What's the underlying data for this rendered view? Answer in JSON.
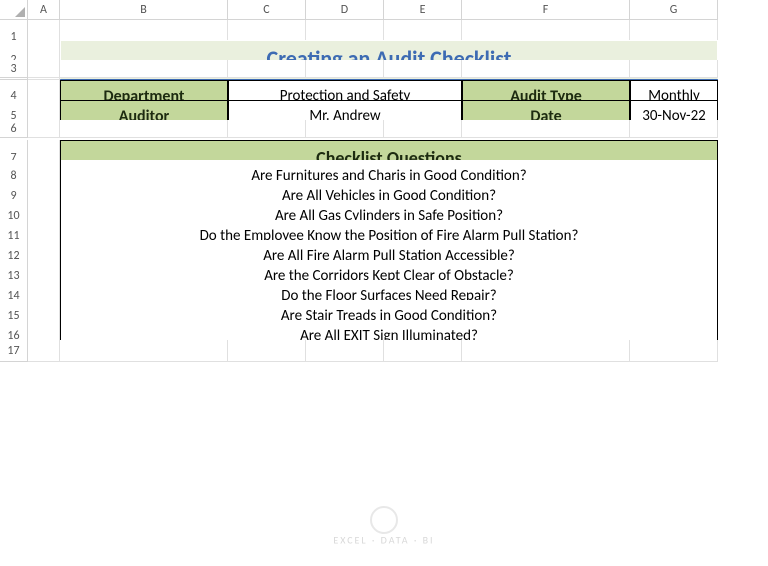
{
  "columns": [
    "A",
    "B",
    "C",
    "D",
    "E",
    "F",
    "G"
  ],
  "rows": [
    "1",
    "2",
    "3",
    "4",
    "5",
    "6",
    "7",
    "8",
    "9",
    "10",
    "11",
    "12",
    "13",
    "14",
    "15",
    "16",
    "17"
  ],
  "title": "Creating an Audit Checklist",
  "meta": {
    "department_label": "Department",
    "department_value": "Protection and Safety",
    "audit_type_label": "Audit Type",
    "audit_type_value": "Monthly",
    "auditor_label": "Auditor",
    "auditor_value": "Mr. Andrew",
    "date_label": "Date",
    "date_value": "30-Nov-22"
  },
  "section_header": "Checklist Questions",
  "questions": [
    "Are Furnitures and Charis in Good Condition?",
    "Are All Vehicles in Good Condition?",
    "Are All Gas Cylinders in Safe Position?",
    "Do the Employee Know the Position of Fire Alarm Pull Station?",
    "Are All Fire Alarm Pull Station Accessible?",
    "Are the Corridors Kept Clear of Obstacle?",
    "Do the Floor Surfaces Need Repair?",
    "Are Stair Treads in Good Condition?",
    "Are All EXIT Sign Illuminated?"
  ],
  "watermark": "EXCEL · DATA · BI"
}
